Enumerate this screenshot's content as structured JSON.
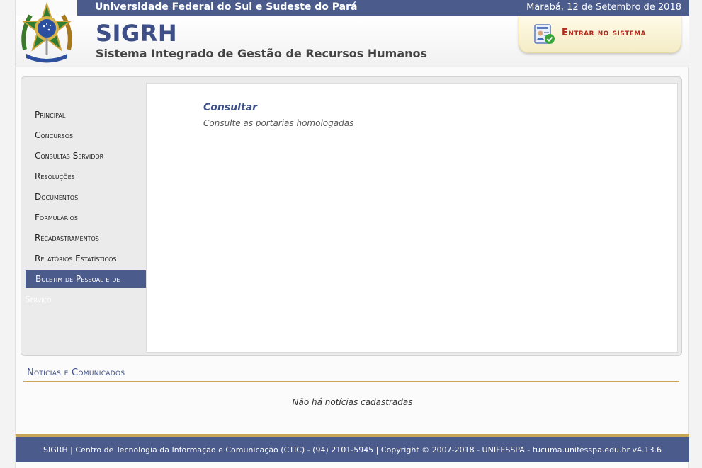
{
  "topbar": {
    "institution": "Universidade Federal do Sul e Sudeste do Pará",
    "date": "Marabá, 12 de Setembro de 2018"
  },
  "header": {
    "title": "SIGRH",
    "subtitle": "Sistema Integrado de Gestão de Recursos Humanos",
    "login_label": "Entrar no sistema"
  },
  "sidebar": {
    "items": [
      {
        "label": "Principal"
      },
      {
        "label": "Concursos"
      },
      {
        "label": "Consultas Servidor"
      },
      {
        "label": "Resoluções"
      },
      {
        "label": "Documentos"
      },
      {
        "label": "Formulários"
      },
      {
        "label": "Recadastramentos"
      },
      {
        "label": "Relatórios Estatísticos"
      },
      {
        "label": "Boletim de Pessoal e de",
        "active": true
      }
    ],
    "overflow_text": "Serviço"
  },
  "content": {
    "title": "Consultar",
    "description": "Consulte as portarias homologadas"
  },
  "news": {
    "heading": "Notícias e Comunicados",
    "empty_message": "Não há notícias cadastradas"
  },
  "footer": {
    "text": "SIGRH | Centro de Tecnologia da Informação e Comunicação (CTIC) - (94) 2101-5945 | Copyright © 2007-2018 - UNIFESSPA - tucuma.unifesspa.edu.br v4.13.6"
  },
  "colors": {
    "primary": "#4b5b8c",
    "accent_gold": "#c9a55a",
    "login_red": "#b22a1d"
  },
  "icons": {
    "emblem": "brazil-coat-of-arms-icon",
    "login": "id-card-check-icon"
  }
}
